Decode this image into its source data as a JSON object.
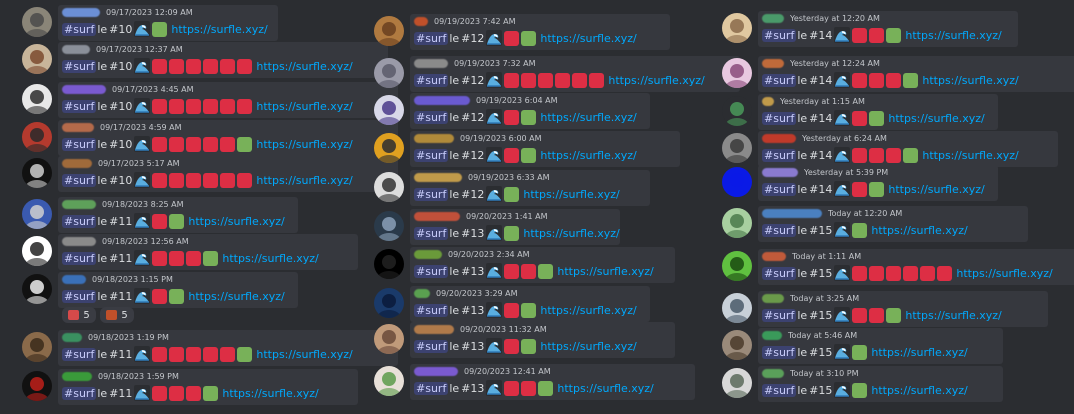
{
  "columns": [
    {
      "messages": [
        {
          "username_hidden": "#6b8fd6",
          "time": "09/17/2023 12:09 AM",
          "tag": "#surf",
          "word": "le",
          "game": "#10",
          "squares": [
            "green"
          ],
          "link": "https://surfle.xyz/",
          "avatar": "#8a8578",
          "avatar2": "#4a4a4a"
        },
        {
          "username_hidden": "#8a8f99",
          "time": "09/17/2023 12:37 AM",
          "tag": "#surf",
          "word": "le",
          "game": "#10",
          "squares": [
            "red",
            "red",
            "red",
            "red",
            "red",
            "red"
          ],
          "link": "https://surfle.xyz/",
          "avatar": "#c8b59a",
          "avatar2": "#7b4a2e"
        },
        {
          "username_hidden": "#7a5ad0",
          "time": "09/17/2023 4:45 AM",
          "tag": "#surf",
          "word": "le",
          "game": "#10",
          "squares": [
            "red",
            "red",
            "red",
            "red",
            "red",
            "red"
          ],
          "link": "https://surfle.xyz/",
          "avatar": "#e8e8e8",
          "avatar2": "#2d2d2d"
        },
        {
          "username_hidden": "#b46a4a",
          "time": "09/17/2023 4:59 AM",
          "tag": "#surf",
          "word": "le",
          "game": "#10",
          "squares": [
            "red",
            "red",
            "red",
            "red",
            "red",
            "green"
          ],
          "link": "https://surfle.xyz/",
          "avatar": "#b43a2e",
          "avatar2": "#2a2a2a"
        },
        {
          "username_hidden": "#a06a3a",
          "time": "09/17/2023 5:17 AM",
          "tag": "#surf",
          "word": "le",
          "game": "#10",
          "squares": [
            "red",
            "red",
            "red",
            "red",
            "red",
            "red"
          ],
          "link": "https://surfle.xyz/",
          "avatar": "#111111",
          "avatar2": "#cfcfcf"
        },
        {
          "username_hidden": "#5ea05a",
          "time": "09/18/2023 8:25 AM",
          "tag": "#surf",
          "word": "le",
          "game": "#11",
          "squares": [
            "red",
            "green"
          ],
          "link": "https://surfle.xyz/",
          "avatar": "#3a5ab0",
          "avatar2": "#d0d0d0"
        },
        {
          "username_hidden": "#8a8a8a",
          "time": "09/18/2023 12:56 AM",
          "tag": "#surf",
          "word": "le",
          "game": "#11",
          "squares": [
            "red",
            "red",
            "red",
            "green"
          ],
          "link": "https://surfle.xyz/",
          "avatar": "#ffffff",
          "avatar2": "#222222"
        },
        {
          "username_hidden": "#3a70b8",
          "time": "09/18/2023 1:15 PM",
          "tag": "#surf",
          "word": "le",
          "game": "#11",
          "squares": [
            "red",
            "green"
          ],
          "link": "https://surfle.xyz/",
          "avatar": "#111111",
          "avatar2": "#eeeeee",
          "reactions": [
            {
              "emoji_color": "#d64a4a",
              "count": "5"
            },
            {
              "emoji_color": "#c0502a",
              "count": "5"
            }
          ]
        },
        {
          "username_hidden": "#3a9060",
          "time": "09/18/2023 1:19 PM",
          "tag": "#surf",
          "word": "le",
          "game": "#11",
          "squares": [
            "red",
            "red",
            "red",
            "red",
            "red",
            "green"
          ],
          "link": "https://surfle.xyz/",
          "avatar": "#8a6a4a",
          "avatar2": "#3a2a1a"
        },
        {
          "username_hidden": "#3a9a3a",
          "time": "09/18/2023 1:59 PM",
          "tag": "#surf",
          "word": "le",
          "game": "#11",
          "squares": [
            "red",
            "red",
            "red",
            "green"
          ],
          "link": "https://surfle.xyz/",
          "avatar": "#111111",
          "avatar2": "#c0201a"
        }
      ]
    },
    {
      "messages": [
        {
          "username_hidden": "#c0502a",
          "time": "09/19/2023 7:42 AM",
          "tag": "#surf",
          "word": "le",
          "game": "#12",
          "squares": [
            "red",
            "green"
          ],
          "link": "https://surfle.xyz/",
          "avatar": "#b07a40",
          "avatar2": "#6a4020"
        },
        {
          "username_hidden": "#8a8a8a",
          "time": "09/19/2023 7:32 AM",
          "tag": "#surf",
          "word": "le",
          "game": "#12",
          "squares": [
            "red",
            "red",
            "red",
            "red",
            "red",
            "red"
          ],
          "link": "https://surfle.xyz/",
          "avatar": "#9a9aa8",
          "avatar2": "#5a5a6a"
        },
        {
          "username_hidden": "#6a5ad0",
          "time": "09/19/2023 6:04 AM",
          "tag": "#surf",
          "word": "le",
          "game": "#12",
          "squares": [
            "red",
            "green"
          ],
          "link": "https://surfle.xyz/",
          "avatar": "#d8d8e8",
          "avatar2": "#4a3a8a"
        },
        {
          "username_hidden": "#b08a3a",
          "time": "09/19/2023 6:00 AM",
          "tag": "#surf",
          "word": "le",
          "game": "#12",
          "squares": [
            "red",
            "green"
          ],
          "link": "https://surfle.xyz/",
          "avatar": "#e0a020",
          "avatar2": "#2b2d31"
        },
        {
          "username_hidden": "#c09a4a",
          "time": "09/19/2023 6:33 AM",
          "tag": "#surf",
          "word": "le",
          "game": "#12",
          "squares": [
            "green"
          ],
          "link": "https://surfle.xyz/",
          "avatar": "#dddddd",
          "avatar2": "#333333"
        },
        {
          "username_hidden": "#c0503a",
          "time": "09/20/2023 1:41 AM",
          "tag": "#surf",
          "word": "le",
          "game": "#13",
          "squares": [
            "green"
          ],
          "link": "https://surfle.xyz/",
          "avatar": "#2a3a4a",
          "avatar2": "#8aa0b8"
        },
        {
          "username_hidden": "#6a9a3a",
          "time": "09/20/2023 2:34 AM",
          "tag": "#surf",
          "word": "le",
          "game": "#13",
          "squares": [
            "red",
            "red",
            "green"
          ],
          "link": "https://surfle.xyz/",
          "avatar": "#000000",
          "avatar2": "#222222"
        },
        {
          "username_hidden": "#5aa050",
          "time": "09/20/2023 3:29 AM",
          "tag": "#surf",
          "word": "le",
          "game": "#13",
          "squares": [
            "red",
            "green"
          ],
          "link": "https://surfle.xyz/",
          "avatar": "#1a3a6a",
          "avatar2": "#0a1a3a"
        },
        {
          "username_hidden": "#b07a4a",
          "time": "09/20/2023 11:32 AM",
          "tag": "#surf",
          "word": "le",
          "game": "#13",
          "squares": [
            "red",
            "green"
          ],
          "link": "https://surfle.xyz/",
          "avatar": "#c09a7a",
          "avatar2": "#6a4a3a"
        },
        {
          "username_hidden": "#7a5ad0",
          "time": "09/20/2023 12:41 AM",
          "tag": "#surf",
          "word": "le",
          "game": "#13",
          "squares": [
            "red",
            "red",
            "green"
          ],
          "link": "https://surfle.xyz/",
          "avatar": "#e8e0d8",
          "avatar2": "#5a9a4a"
        }
      ]
    },
    {
      "messages": [
        {
          "username_hidden": "#4a9a6a",
          "time": "Yesterday at 12:20 AM",
          "tag": "#surf",
          "word": "le",
          "game": "#14",
          "squares": [
            "red",
            "red",
            "green"
          ],
          "link": "https://surfle.xyz/",
          "avatar": "#e0c8a0",
          "avatar2": "#8a6a4a"
        },
        {
          "username_hidden": "#c06a3a",
          "time": "Yesterday at 12:24 AM",
          "tag": "#surf",
          "word": "le",
          "game": "#14",
          "squares": [
            "red",
            "red",
            "red",
            "green"
          ],
          "link": "https://surfle.xyz/",
          "avatar": "#e8c8e0",
          "avatar2": "#8a4a7a"
        },
        {
          "username_hidden": "#c09a4a",
          "time": "Yesterday at 1:15 AM",
          "tag": "#surf",
          "word": "le",
          "game": "#14",
          "squares": [
            "red",
            "green"
          ],
          "link": "https://surfle.xyz/",
          "avatar": "#2b2d31",
          "avatar2": "#4a9a5a"
        },
        {
          "username_hidden": "#c03a2a",
          "time": "Yesterday at 6:24 AM",
          "tag": "#surf",
          "word": "le",
          "game": "#14",
          "squares": [
            "red",
            "red",
            "red",
            "green"
          ],
          "link": "https://surfle.xyz/",
          "avatar": "#8a8a8a",
          "avatar2": "#3a3a3a"
        },
        {
          "username_hidden": "#8a7ad0",
          "time": "Yesterday at 5:39 PM",
          "tag": "#surf",
          "word": "le",
          "game": "#14",
          "squares": [
            "red",
            "green"
          ],
          "link": "https://surfle.xyz/",
          "avatar": "#0a1ae6",
          "avatar2": "#0a1ae6"
        },
        {
          "username_hidden": "#4a80c0",
          "time": "Today at 12:20 AM",
          "tag": "#surf",
          "word": "le",
          "game": "#15",
          "squares": [
            "green"
          ],
          "link": "https://surfle.xyz/",
          "avatar": "#a8d0a0",
          "avatar2": "#4a7a4a"
        },
        {
          "username_hidden": "#c05a3a",
          "time": "Today at 1:11 AM",
          "tag": "#surf",
          "word": "le",
          "game": "#15",
          "squares": [
            "red",
            "red",
            "red",
            "red",
            "red",
            "red"
          ],
          "link": "https://surfle.xyz/",
          "avatar": "#60c040",
          "avatar2": "#1a4a10"
        },
        {
          "username_hidden": "#6a9a4a",
          "time": "Today at 3:25 AM",
          "tag": "#surf",
          "word": "le",
          "game": "#15",
          "squares": [
            "red",
            "red",
            "green"
          ],
          "link": "https://surfle.xyz/",
          "avatar": "#c8d0d8",
          "avatar2": "#4a5a6a"
        },
        {
          "username_hidden": "#3a9a5a",
          "time": "Today at 5:46 AM",
          "tag": "#surf",
          "word": "le",
          "game": "#15",
          "squares": [
            "green"
          ],
          "link": "https://surfle.xyz/",
          "avatar": "#9a8a7a",
          "avatar2": "#4a3a2a"
        },
        {
          "username_hidden": "#5aa05a",
          "time": "Today at 3:10 PM",
          "tag": "#surf",
          "word": "le",
          "game": "#15",
          "squares": [
            "green"
          ],
          "link": "https://surfle.xyz/",
          "avatar": "#d8d8d8",
          "avatar2": "#5a6a5a"
        }
      ]
    }
  ],
  "colors": {
    "red_square": "#dd2e44",
    "green_square": "#78b159",
    "link": "#00a8fc",
    "background": "#2b2d31",
    "tag_bg": "#3c4270"
  }
}
